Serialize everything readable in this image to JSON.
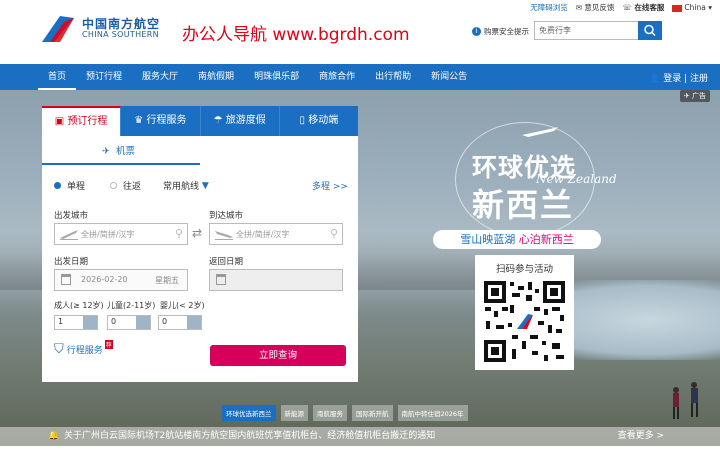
{
  "brand": {
    "name_cn": "中国南方航空",
    "name_en": "CHINA SOUTHERN"
  },
  "watermark": "办公人导航  www.bgrdh.com",
  "toplinks": {
    "accessible": "无障碍浏览",
    "feedback": "意见反馈",
    "service": "在线客服",
    "country": "China"
  },
  "safety": "购票安全提示",
  "search": {
    "placeholder": "免费行李"
  },
  "nav": [
    "首页",
    "预订行程",
    "服务大厅",
    "南航假期",
    "明珠俱乐部",
    "商旅合作",
    "出行帮助",
    "新闻公告"
  ],
  "login": {
    "login": "登录",
    "register": "注册"
  },
  "ad_label": "广告",
  "panel": {
    "tabs": [
      "预订行程",
      "行程服务",
      "旅游度假",
      "移动端"
    ],
    "subtab": "机票",
    "trip": {
      "oneway": "单程",
      "round": "往返",
      "common": "常用航线",
      "multi": "多程 >>"
    },
    "from_label": "出发城市",
    "to_label": "到达城市",
    "city_placeholder": "全拼/简拼/汉字",
    "depart_label": "出发日期",
    "return_label": "返回日期",
    "depart_date": "2026-02-20",
    "weekday": "星期五",
    "adult_label": "成人(≥ 12岁)",
    "child_label": "儿童(2-11岁)",
    "infant_label": "婴儿(< 2岁)",
    "adult": "1",
    "child": "0",
    "infant": "0",
    "service": "行程服务",
    "hot": "荐",
    "search_btn": "立即查询"
  },
  "promo": {
    "title1": "环球优选",
    "title2": "新西兰",
    "en": "New Zealand",
    "banner_b": "雪山映蓝湖",
    "banner_r": "心泊新西兰",
    "qr_label": "扫码参与活动"
  },
  "chips": [
    "环球优选新西兰",
    "新能源",
    "南航服务",
    "国际新开航",
    "南航中转住宿2026年"
  ],
  "notice": "关于广州白云国际机场T2航站楼南方航空国内航班优享值机柜台、经济舱值机柜台搬迁的通知",
  "more": "查看更多 >",
  "colors": {
    "primary": "#1b6fc2",
    "accent": "#d6001c",
    "button": "#d6005a"
  }
}
